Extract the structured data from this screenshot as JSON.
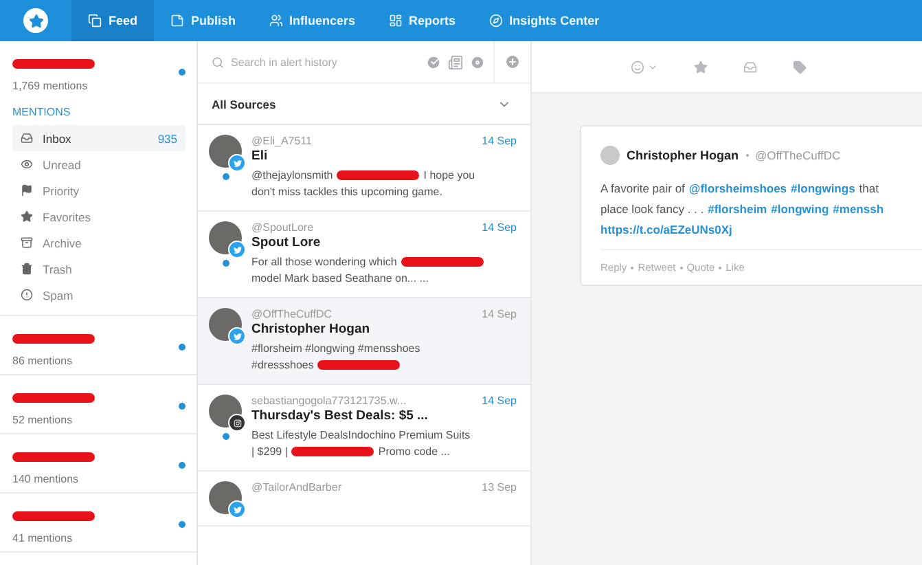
{
  "nav": {
    "items": [
      {
        "label": "Feed",
        "selected": true
      },
      {
        "label": "Publish",
        "selected": false
      },
      {
        "label": "Influencers",
        "selected": false
      },
      {
        "label": "Reports",
        "selected": false
      },
      {
        "label": "Insights Center",
        "selected": false
      }
    ]
  },
  "sidebar": {
    "accounts": [
      {
        "mentions": "1,769 mentions",
        "unread": true,
        "section_title": "MENTIONS",
        "items": [
          {
            "label": "Inbox",
            "count": "935",
            "selected": true
          },
          {
            "label": "Unread",
            "selected": false
          },
          {
            "label": "Priority",
            "selected": false
          },
          {
            "label": "Favorites",
            "selected": false
          },
          {
            "label": "Archive",
            "selected": false
          },
          {
            "label": "Trash",
            "selected": false
          },
          {
            "label": "Spam",
            "selected": false
          }
        ]
      },
      {
        "mentions": "86 mentions",
        "unread": true
      },
      {
        "mentions": "52 mentions",
        "unread": true
      },
      {
        "mentions": "140 mentions",
        "unread": true
      },
      {
        "mentions": "41 mentions",
        "unread": true
      }
    ]
  },
  "feed": {
    "search": {
      "placeholder": "Search in alert history"
    },
    "source_filter": "All Sources",
    "items": [
      {
        "handle": "@Eli_A7511",
        "name": "Eli",
        "date": "14 Sep",
        "kind": "twitter",
        "unread": true,
        "selected": false,
        "lines": [
          [
            {
              "kind": "text",
              "text": "@thejaylonsmith"
            },
            {
              "kind": "redaction"
            },
            {
              "kind": "text",
              "text": "I hope you"
            }
          ],
          [
            {
              "kind": "text",
              "text": "don't miss tackles this upcoming game."
            }
          ]
        ]
      },
      {
        "handle": "@SpoutLore",
        "name": "Spout Lore",
        "date": "14 Sep",
        "kind": "twitter",
        "unread": true,
        "selected": false,
        "lines": [
          [
            {
              "kind": "text",
              "text": "For all those wondering which"
            },
            {
              "kind": "redaction"
            }
          ],
          [
            {
              "kind": "text",
              "text": "model Mark based Seathane on... ..."
            }
          ]
        ]
      },
      {
        "handle": "@OffTheCuffDC",
        "name": "Christopher Hogan",
        "date": "14 Sep",
        "kind": "twitter",
        "unread": false,
        "selected": true,
        "lines": [
          [
            {
              "kind": "text",
              "text": "#florsheim #longwing #mensshoes"
            }
          ],
          [
            {
              "kind": "text",
              "text": "#dressshoes"
            },
            {
              "kind": "redaction"
            }
          ]
        ]
      },
      {
        "handle": "sebastiangogola773121735.w...",
        "name": "Thursday's Best Deals: $5 ...",
        "date": "14 Sep",
        "kind": "instagram",
        "unread": true,
        "selected": false,
        "lines": [
          [
            {
              "kind": "text",
              "text": "Best Lifestyle DealsIndochino Premium Suits"
            }
          ],
          [
            {
              "kind": "text",
              "text": "| $299 |"
            },
            {
              "kind": "redaction"
            },
            {
              "kind": "text",
              "text": "Promo code ..."
            }
          ]
        ]
      },
      {
        "handle": "@TailorAndBarber",
        "date": "13 Sep",
        "kind": "twitter",
        "unread": false,
        "selected": false
      }
    ]
  },
  "detail": {
    "post": {
      "name": "Christopher Hogan",
      "handle": "@OffTheCuffDC",
      "lines": [
        [
          {
            "kind": "text",
            "text": "A favorite pair of"
          },
          {
            "kind": "link",
            "text": "@florsheimshoes"
          },
          {
            "kind": "link",
            "text": "#longwings"
          },
          {
            "kind": "text",
            "text": "that"
          }
        ],
        [
          {
            "kind": "text",
            "text": "place look fancy . . ."
          },
          {
            "kind": "link",
            "text": "#florsheim"
          },
          {
            "kind": "link",
            "text": "#longwing"
          },
          {
            "kind": "link",
            "text": "#menssh"
          }
        ],
        [
          {
            "kind": "link",
            "text": "https://t.co/aEZeUNs0Xj"
          }
        ]
      ],
      "actions": [
        "Reply",
        "Retweet",
        "Quote",
        "Like"
      ]
    }
  }
}
